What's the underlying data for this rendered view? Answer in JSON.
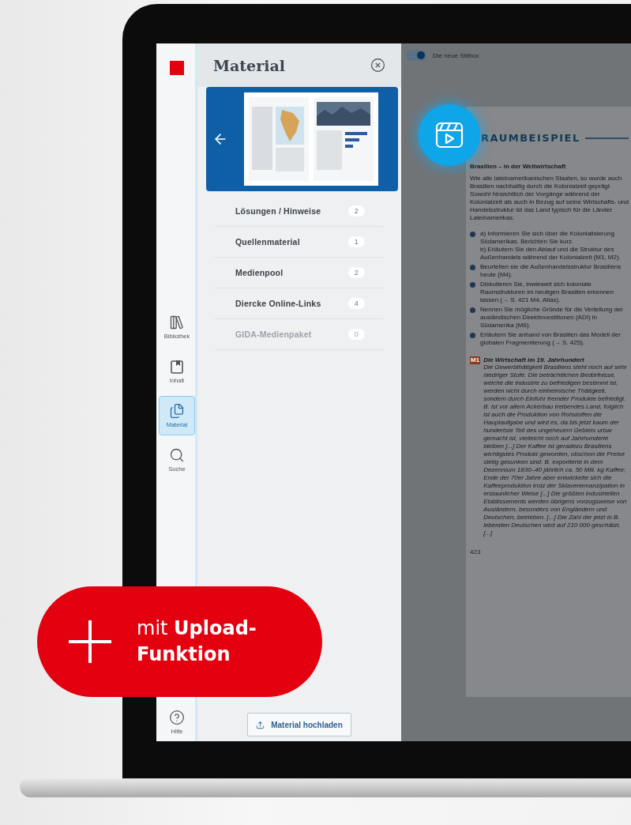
{
  "rail": {
    "items": [
      {
        "kind": "library",
        "label": "Bibliothek",
        "selected": false
      },
      {
        "kind": "contents",
        "label": "Inhalt",
        "selected": false
      },
      {
        "kind": "material",
        "label": "Material",
        "selected": true
      },
      {
        "kind": "search",
        "label": "Suche",
        "selected": false
      }
    ],
    "help": {
      "label": "Hilfe"
    }
  },
  "panel": {
    "title": "Material",
    "items": [
      {
        "label": "Lösungen / Hinweise",
        "count": "2",
        "disabled": false
      },
      {
        "label": "Quellenmaterial",
        "count": "1",
        "disabled": false
      },
      {
        "label": "Medienpool",
        "count": "2",
        "disabled": false
      },
      {
        "label": "Diercke Online-Links",
        "count": "4",
        "disabled": false
      },
      {
        "label": "GIDA-Medienpaket",
        "count": "0",
        "disabled": true
      }
    ],
    "upload_button": "Material hochladen"
  },
  "document": {
    "toggle": {
      "label": "Die neue Stilbox",
      "on": true
    },
    "heading": "RAUMBEISPIEL",
    "subtitle": "Brasilien – in der Weltwirtschaft",
    "intro": "Wie alle lateinamerikanischen Staaten, so wurde auch Brasilien nachhaltig durch die Kolonialzeit geprägt. Sowohl hinsichtlich der Vorgänge während der Kolonialzeit als auch in Bezug auf seine Wirtschafts- und Handelsstruktur ist das Land typisch für die Länder Lateinamerikas.",
    "tasks": [
      {
        "lines": [
          "a) Informieren Sie sich über die Kolonialisierung Südamerikas. Berichten Sie kurz.",
          "b) Erläutern Sie den Ablauf und die Struktur des Außenhandels während der Kolonialzeit (M1, M2)."
        ]
      },
      {
        "lines": [
          "Beurteilen sie die Außenhandelsstruktur Brasiliens heute (M4)."
        ]
      },
      {
        "lines": [
          "Diskutieren Sie, inwieweit sich koloniale Raumstrukturen im heutigen Brasilien erkennen lassen (→ S. 421 M4, Atlas)."
        ]
      },
      {
        "lines": [
          "Nennen Sie mögliche Gründe für die Verteilung der ausländischen Direktinvestitionen (ADI) in Südamerika (M6)."
        ]
      },
      {
        "lines": [
          "Erläutern Sie anhand von Brasilien das Modell der globalen Fragmentierung (→ S. 425)."
        ]
      }
    ],
    "source": {
      "tag": "M1",
      "title": "Die Wirtschaft im 19. Jahrhundert",
      "text": "Die Gewerbthätigkeit Brasiliens steht noch auf sehr niedriger Stufe. Die beträchtlichen Bedürfnisse, welche die Industrie zu befriedigen bestimmt ist, werden nicht durch einheimische Thätigkeit, sondern durch Einfuhr fremder Produkte befriedigt. B. ist vor allem Ackerbau treibendes Land, folglich ist auch die Produktion von Rohstoffen die Hauptaufgabe und wird es, da bis jetzt kaum der hundertste Teil des ungeheuern Gebiets urbar gemacht ist, vielleicht noch auf Jahrhunderte bleiben [...] Der Kaffee ist geradezu Brasiliens wichtigstes Produkt geworden, obschon die Preise stetig gesunken sind. B. exportierte in dem Dezennium 1830–40 jährlich ca. 50 Mill. kg Kaffee; Ende der 70er Jahre aber entwickelte sich die Kaffeeproduktion trotz der Sklavenemanzipation in erstaunlicher Weise [...] Die größten industriellen Etablissements werden übrigens vorzugsweise von Ausländern, besonders von Engländern und Deutschen, betrieben. [...] Die Zahl der jetzt in B. lebenden Deutschen wird auf 210 000 geschätzt. [...]"
    },
    "page_number": "423"
  },
  "badge": {
    "text": "mit **Upload-Funktion**"
  }
}
